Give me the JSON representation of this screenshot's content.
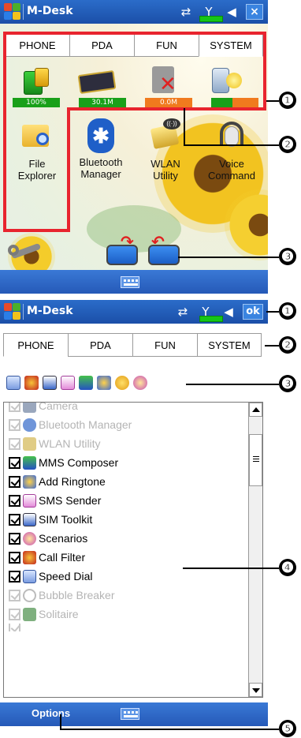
{
  "top_screen": {
    "title": "M-Desk",
    "tabs": [
      "PHONE",
      "PDA",
      "FUN",
      "SYSTEM"
    ],
    "status_bars": [
      {
        "label": "100%",
        "color": "#19a019",
        "fill": 1.0
      },
      {
        "label": "30.1M",
        "color": "#19a019",
        "fill": 1.0
      },
      {
        "label": "0.0M",
        "color": "#f07a1e",
        "fill": 1.0
      },
      {
        "label": "",
        "color": "#19a019",
        "fill": 0.45
      }
    ],
    "apps": [
      {
        "label_line1": "File",
        "label_line2": "Explorer",
        "icon": "folder-search-icon"
      },
      {
        "label_line1": "Bluetooth",
        "label_line2": "Manager",
        "icon": "bluetooth-icon"
      },
      {
        "label_line1": "WLAN",
        "label_line2": "Utility",
        "icon": "wifi-icon"
      },
      {
        "label_line1": "Voice",
        "label_line2": "Command",
        "icon": "headset-icon"
      }
    ]
  },
  "bottom_screen": {
    "title": "M-Desk",
    "ok_label": "ok",
    "tabs": [
      "PHONE",
      "PDA",
      "FUN",
      "SYSTEM"
    ],
    "list_items": [
      {
        "label": "Camera",
        "enabled": false
      },
      {
        "label": "Bluetooth Manager",
        "enabled": false
      },
      {
        "label": "WLAN Utility",
        "enabled": false
      },
      {
        "label": "MMS Composer",
        "enabled": true
      },
      {
        "label": "Add Ringtone",
        "enabled": true
      },
      {
        "label": "SMS Sender",
        "enabled": true
      },
      {
        "label": "SIM Toolkit",
        "enabled": true
      },
      {
        "label": "Scenarios",
        "enabled": true
      },
      {
        "label": "Call Filter",
        "enabled": true
      },
      {
        "label": "Speed Dial",
        "enabled": true
      },
      {
        "label": "Bubble Breaker",
        "enabled": false
      },
      {
        "label": "Solitaire",
        "enabled": false
      }
    ],
    "options_label": "Options"
  },
  "callouts": {
    "c1_top": "❶",
    "c2_top": "❷",
    "c3_top": "❸",
    "c1_bottom": "❶",
    "c2_bottom": "❷",
    "c3_bottom": "❸",
    "c4_bottom": "❹",
    "c5_bottom": "❺"
  },
  "colors": {
    "title_bar": "#1b4fa8",
    "highlight_box": "#e8242e"
  }
}
